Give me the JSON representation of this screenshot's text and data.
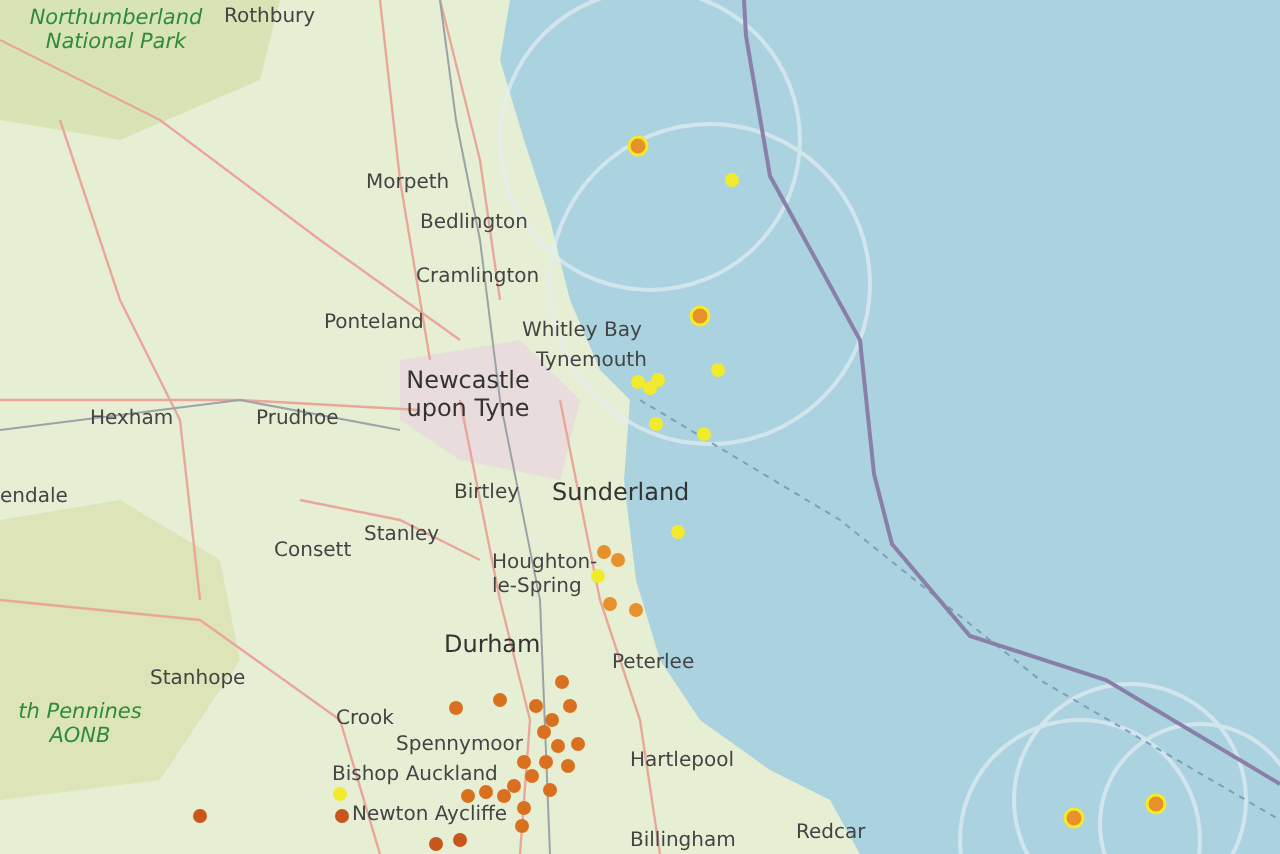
{
  "map": {
    "labels": [
      {
        "text": "Northumberland National Park",
        "kind": "park"
      },
      {
        "text": "Rothbury",
        "kind": "town"
      },
      {
        "text": "Morpeth",
        "kind": "town"
      },
      {
        "text": "Bedlington",
        "kind": "town"
      },
      {
        "text": "Cramlington",
        "kind": "town"
      },
      {
        "text": "Ponteland",
        "kind": "town"
      },
      {
        "text": "Whitley Bay",
        "kind": "town"
      },
      {
        "text": "Tynemouth",
        "kind": "town"
      },
      {
        "text": "Hexham",
        "kind": "town"
      },
      {
        "text": "Prudhoe",
        "kind": "town"
      },
      {
        "text": "Newcastle upon Tyne",
        "kind": "city"
      },
      {
        "text": "endale",
        "kind": "town"
      },
      {
        "text": "Birtley",
        "kind": "town"
      },
      {
        "text": "Sunderland",
        "kind": "city"
      },
      {
        "text": "Stanley",
        "kind": "town"
      },
      {
        "text": "Consett",
        "kind": "town"
      },
      {
        "text": "Houghton-le-Spring",
        "kind": "town"
      },
      {
        "text": "Durham",
        "kind": "city"
      },
      {
        "text": "Stanhope",
        "kind": "town"
      },
      {
        "text": "th Pennines AONB",
        "kind": "park"
      },
      {
        "text": "Crook",
        "kind": "town"
      },
      {
        "text": "Spennymoor",
        "kind": "town"
      },
      {
        "text": "Peterlee",
        "kind": "town"
      },
      {
        "text": "Bishop Auckland",
        "kind": "town"
      },
      {
        "text": "Hartlepool",
        "kind": "town"
      },
      {
        "text": "Newton Aycliffe",
        "kind": "town"
      },
      {
        "text": "Billingham",
        "kind": "town"
      },
      {
        "text": "Redcar",
        "kind": "town"
      }
    ],
    "markers": [
      {
        "kind": "ringed",
        "color": "#e8912a"
      },
      {
        "kind": "dot",
        "color": "#f2ea2c"
      },
      {
        "kind": "ringed",
        "color": "#e8912a"
      },
      {
        "kind": "dot",
        "color": "#f2ea2c"
      },
      {
        "kind": "dot",
        "color": "#f2ea2c"
      },
      {
        "kind": "dot",
        "color": "#f2ea2c"
      },
      {
        "kind": "dot",
        "color": "#f2ea2c"
      },
      {
        "kind": "dot",
        "color": "#f2ea2c"
      },
      {
        "kind": "dot",
        "color": "#f2ea2c"
      },
      {
        "kind": "dot",
        "color": "#f2ea2c"
      },
      {
        "kind": "dot",
        "color": "#f2ea2c"
      },
      {
        "kind": "dot",
        "color": "#e8912a"
      },
      {
        "kind": "dot",
        "color": "#e8912a"
      },
      {
        "kind": "dot",
        "color": "#e8912a"
      },
      {
        "kind": "dot",
        "color": "#e8912a"
      },
      {
        "kind": "ringed",
        "color": "#e8912a"
      },
      {
        "kind": "ringed",
        "color": "#e8912a"
      },
      {
        "kind": "dot",
        "color": "#d9701f"
      },
      {
        "kind": "dot",
        "color": "#d9701f"
      },
      {
        "kind": "dot",
        "color": "#d9701f"
      },
      {
        "kind": "dot",
        "color": "#d9701f"
      },
      {
        "kind": "dot",
        "color": "#d9701f"
      },
      {
        "kind": "dot",
        "color": "#d9701f"
      },
      {
        "kind": "dot",
        "color": "#d9701f"
      },
      {
        "kind": "dot",
        "color": "#d9701f"
      },
      {
        "kind": "dot",
        "color": "#d9701f"
      },
      {
        "kind": "dot",
        "color": "#d9701f"
      },
      {
        "kind": "dot",
        "color": "#d9701f"
      },
      {
        "kind": "dot",
        "color": "#d9701f"
      },
      {
        "kind": "dot",
        "color": "#d9701f"
      },
      {
        "kind": "dot",
        "color": "#d9701f"
      },
      {
        "kind": "dot",
        "color": "#d9701f"
      },
      {
        "kind": "dot",
        "color": "#d9701f"
      },
      {
        "kind": "dot",
        "color": "#c8561a"
      },
      {
        "kind": "dot",
        "color": "#c8561a"
      },
      {
        "kind": "dot",
        "color": "#f2ea2c"
      },
      {
        "kind": "dot",
        "color": "#c8561a"
      },
      {
        "kind": "dot",
        "color": "#c8561a"
      },
      {
        "kind": "dot",
        "color": "#d9701f"
      },
      {
        "kind": "dot",
        "color": "#d9701f"
      },
      {
        "kind": "dot",
        "color": "#d9701f"
      },
      {
        "kind": "dot",
        "color": "#d9701f"
      }
    ]
  }
}
